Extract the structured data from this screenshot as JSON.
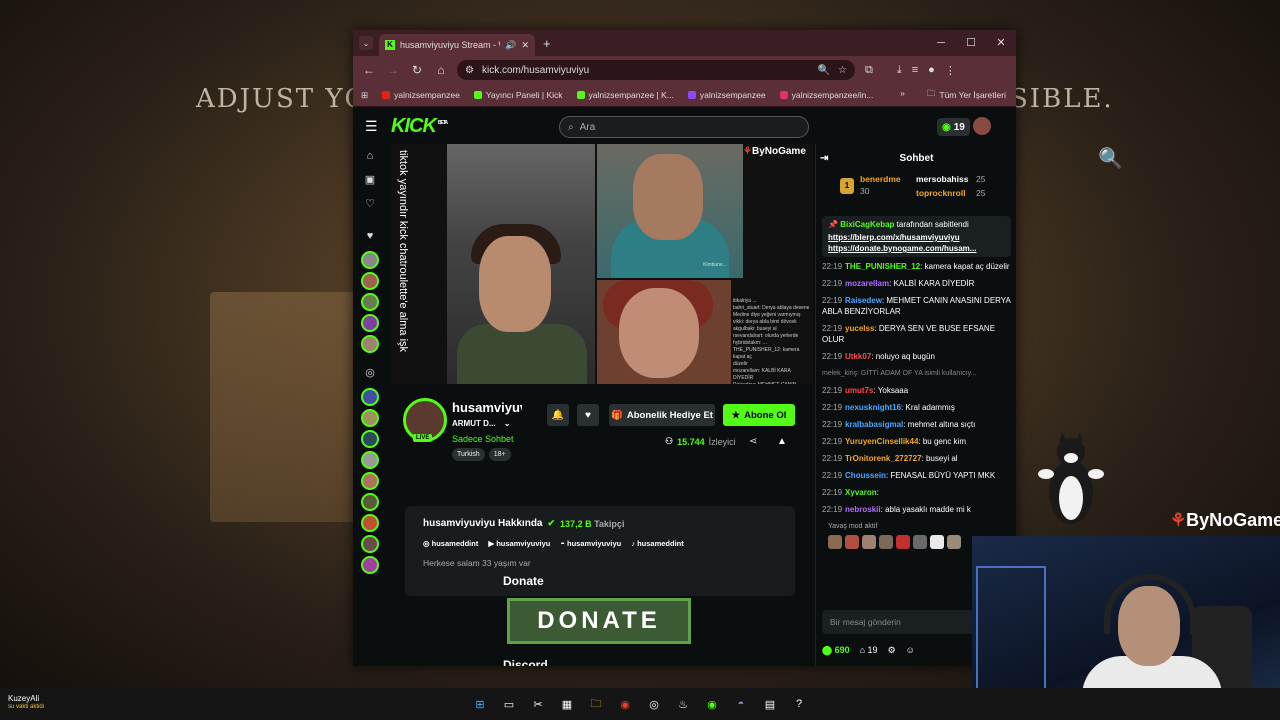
{
  "background": {
    "top_text_left": "ADJUST YOU",
    "top_text_right": "SIBLE.",
    "bynogame_overlay": "ByNoGame"
  },
  "browser": {
    "tab_title": "husamviyuviyu Stream - Wa",
    "url": "kick.com/husamviyuviyu",
    "bookmarks": [
      {
        "label": "yalnizsempanzee",
        "color": "#e62117"
      },
      {
        "label": "Yayıncı Paneli | Kick",
        "color": "#53fc18"
      },
      {
        "label": "yalnizsempanzee | K...",
        "color": "#53fc18"
      },
      {
        "label": "yalnizsempanzee",
        "color": "#9146ff"
      },
      {
        "label": "yalnizsempanzee/in...",
        "color": "#e1306c"
      }
    ],
    "bookmarks_folder": "Tüm Yer İşaretleri"
  },
  "kick": {
    "logo": "KICK",
    "logo_beta": "BETA",
    "search_placeholder": "Ara",
    "header_badge": "19",
    "player": {
      "vertical_text": "tiktok yayındır kick chatroulette'e alma işk",
      "bynogame": "ByNoGame",
      "cam_caption": "Kimbune...",
      "chat_overlay": "itikalriya ...\nbahri_stuart: Derya ablaya desene\nMedine diye yeğeni varmıymış\nvikki: derya abla bimi dövcek\nakgulbaki: buseyi al\nrsevandalrart: olurda yerlerde\nhybridstakm: ...\nTHE_PUNISHER_12: kamera kapat aç\ndüzelir\nmozarellam: KALBİ KARA DİYEDİR\nRaisedew: MEHMET CANIN ANASINI\nDERYA ABLA BENZİYORLAR"
    },
    "channel": {
      "name": "husamviyuviyu",
      "category": "ARMUT D...",
      "live": "LIVE",
      "sub_only": "Sadece Sohbet",
      "tags": [
        "Turkish",
        "18+"
      ],
      "gift_button": "Abonelik Hediye Et",
      "subscribe_button": "Abone Ol",
      "viewers": "15.744",
      "viewers_label": "İzleyici"
    },
    "about": {
      "title": "husamviyuviyu Hakkında",
      "followers": "137,2 B",
      "followers_label": "Takipçi",
      "socials": [
        "husameddint",
        "husamviyuviyu",
        "husamviyuviyu",
        "husameddint"
      ],
      "bio": "Herkese salam 33 yaşım var"
    },
    "panels": {
      "donate_title": "Donate",
      "donate_image_text": "DONATE",
      "discord_title": "Discord"
    },
    "chat": {
      "title": "Sohbet",
      "leaderboard": [
        {
          "rank": "1",
          "name": "benerdme",
          "count": "30"
        },
        {
          "name": "mersobahiss",
          "count": "25"
        },
        {
          "name": "toprocknroll",
          "count": "25"
        }
      ],
      "pinned_by": "BixiCagKebap",
      "pinned_label": "tarafından sabitlendi",
      "pinned_link1": "https://blerp.com/x/husamviyuviyu",
      "pinned_link2": "https://donate.bynogame.com/husam...",
      "messages": [
        {
          "time": "22:19",
          "user": "THE_PUNISHER_12",
          "color": "#53fc18",
          "text": "kamera kapat aç düzelir"
        },
        {
          "time": "22:19",
          "user": "mozarellam",
          "color": "#b36bff",
          "text": "KALBİ KARA DİYEDİR"
        },
        {
          "time": "22:19",
          "user": "Raisedew",
          "color": "#4aa8ff",
          "text": "MEHMET CANIN ANASINI DERYA ABLA BENZİYORLAR"
        },
        {
          "time": "22:19",
          "user": "yucelss",
          "color": "#f5a623",
          "text": "DERYA SEN VE BUSE EFSANE OLUR"
        },
        {
          "time": "22:19",
          "user": "Utkk07",
          "color": "#ff4a4a",
          "text": "noluyo aq bugün"
        },
        {
          "time": "22:19",
          "user": "umut7s",
          "color": "#ff4a4a",
          "text": "Yoksaaa"
        },
        {
          "time": "22:19",
          "user": "nexusknight16",
          "color": "#4aa8ff",
          "text": "Kral adammış"
        },
        {
          "time": "22:19",
          "user": "kralbabasigmal",
          "color": "#4aa8ff",
          "text": "mehmet altına sıçtı"
        },
        {
          "time": "22:19",
          "user": "YuruyenCinsellik44",
          "color": "#f5a623",
          "text": "bu genc kim"
        },
        {
          "time": "22:19",
          "user": "TrOnitorenk_272727",
          "color": "#f5a623",
          "text": "buseyi al"
        },
        {
          "time": "22:19",
          "user": "Choussein",
          "color": "#4aa8ff",
          "text": "FENASAL BÜYÜ YAPTI MKK"
        },
        {
          "time": "22:19",
          "user": "Xyvaron",
          "color": "#53fc18",
          "text": ""
        },
        {
          "time": "22:19",
          "user": "nebroskii",
          "color": "#b36bff",
          "text": "abla yasaklı madde mi k"
        }
      ],
      "system_line": "melek_kiriş: GİTTİ ADAM OF YA isimli kullanıcıy...",
      "slow_mode": "Yavaş mod aktif",
      "input_placeholder": "Bir mesaj gönderin",
      "points": "690",
      "gift_count": "19"
    }
  },
  "taskbar": {
    "weather_title": "KuzeyAli",
    "weather_sub": "su vakti aktidı"
  }
}
